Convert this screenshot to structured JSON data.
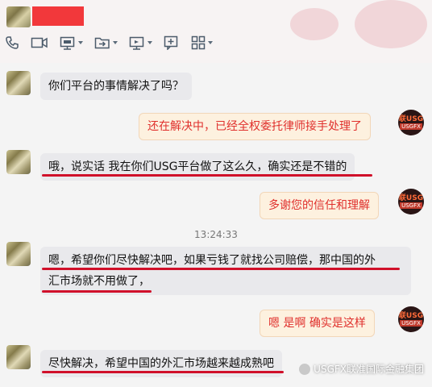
{
  "messages": [
    {
      "side": "left",
      "text": "你们平台的事情解决了吗？"
    },
    {
      "side": "right",
      "text": "还在解决中，已经全权委托律师接手处理了"
    },
    {
      "side": "left",
      "text": "哦，说实话 我在你们USG平台做了这么久，确实还是不错的"
    },
    {
      "side": "right",
      "text": "多谢您的信任和理解"
    },
    {
      "side": "left",
      "line1": "嗯，希望你们尽快解决吧，如果亏钱了就找公司赔偿，那中国的外",
      "line2": "汇市场就不用做了，"
    },
    {
      "side": "right",
      "text": "嗯  是啊  确实是这样"
    },
    {
      "side": "left",
      "text": "尽快解决，希望中国的外汇市场越来越成熟吧"
    }
  ],
  "timestamp": "13:24:33",
  "avatar_right": {
    "line1": "联USG",
    "line2": "USGFX"
  },
  "watermark": "USGFX联准国际金融集团",
  "colors": {
    "sender_bubble": "#fdf1df",
    "sender_text": "#e0302c",
    "receiver_bubble": "#e9e9ec",
    "underline": "#d0102a",
    "redaction": "#f2383b"
  },
  "icons": [
    "phone-icon",
    "video-icon",
    "screen-share-icon",
    "file-transfer-icon",
    "remote-desktop-icon",
    "add-icon",
    "apps-grid-icon"
  ]
}
